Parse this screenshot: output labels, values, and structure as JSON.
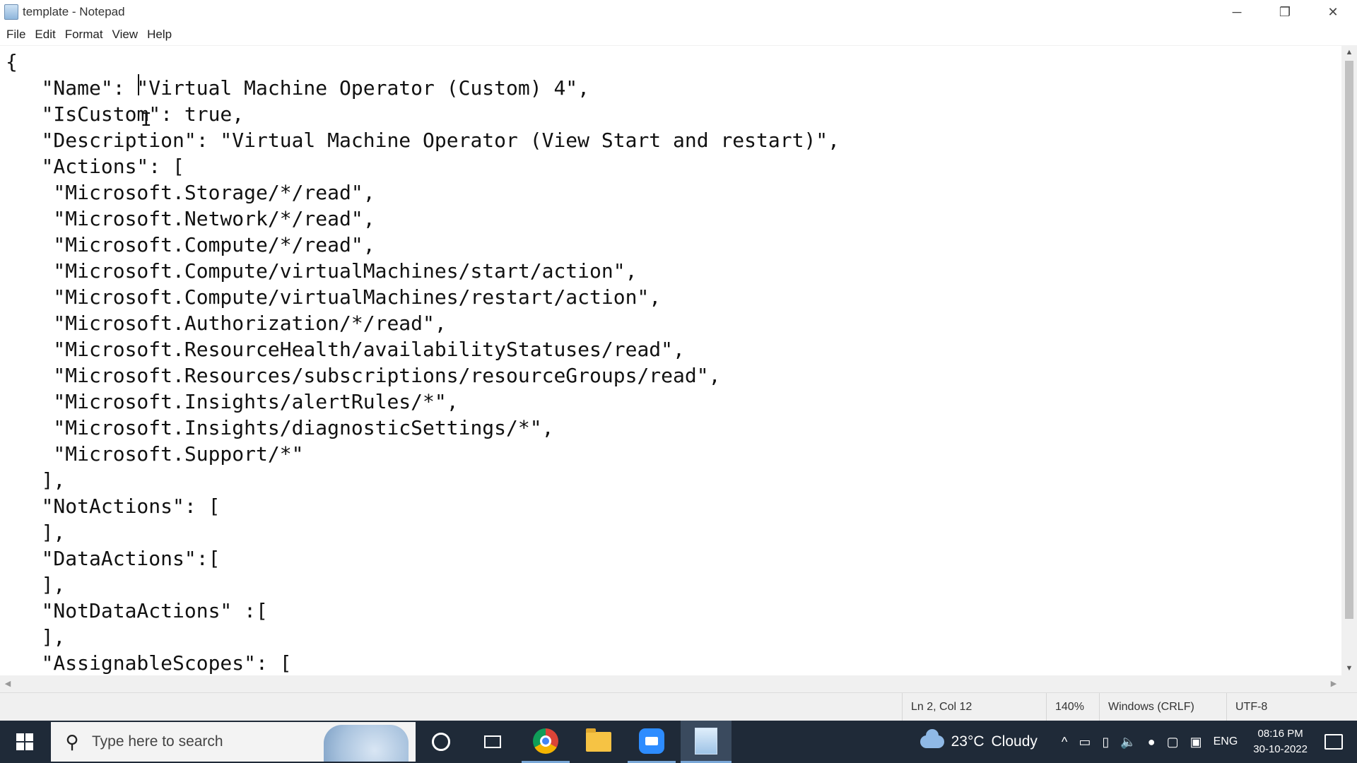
{
  "window": {
    "title": "template - Notepad",
    "controls": {
      "minimize": "─",
      "restore": "❐",
      "close": "✕"
    }
  },
  "menu": [
    "File",
    "Edit",
    "Format",
    "View",
    "Help"
  ],
  "editor": {
    "lines": [
      "{",
      "   \"Name\": \"Virtual Machine Operator (Custom) 4\",",
      "   \"IsCustom\": true,",
      "   \"Description\": \"Virtual Machine Operator (View Start and restart)\",",
      "   \"Actions\": [",
      "    \"Microsoft.Storage/*/read\",",
      "    \"Microsoft.Network/*/read\",",
      "    \"Microsoft.Compute/*/read\",",
      "    \"Microsoft.Compute/virtualMachines/start/action\",",
      "    \"Microsoft.Compute/virtualMachines/restart/action\",",
      "    \"Microsoft.Authorization/*/read\",",
      "    \"Microsoft.ResourceHealth/availabilityStatuses/read\",",
      "    \"Microsoft.Resources/subscriptions/resourceGroups/read\",",
      "    \"Microsoft.Insights/alertRules/*\",",
      "    \"Microsoft.Insights/diagnosticSettings/*\",",
      "    \"Microsoft.Support/*\"",
      "   ],",
      "   \"NotActions\": [",
      "   ],",
      "   \"DataActions\":[",
      "   ],",
      "   \"NotDataActions\" :[",
      "   ],",
      "   \"AssignableScopes\": ["
    ]
  },
  "status": {
    "position": "Ln 2, Col 12",
    "zoom": "140%",
    "line_ending": "Windows (CRLF)",
    "encoding": "UTF-8"
  },
  "taskbar": {
    "search_placeholder": "Type here to search",
    "weather": {
      "temp": "23°C",
      "condition": "Cloudy"
    },
    "language": "ENG",
    "time": "08:16 PM",
    "date": "30-10-2022"
  }
}
